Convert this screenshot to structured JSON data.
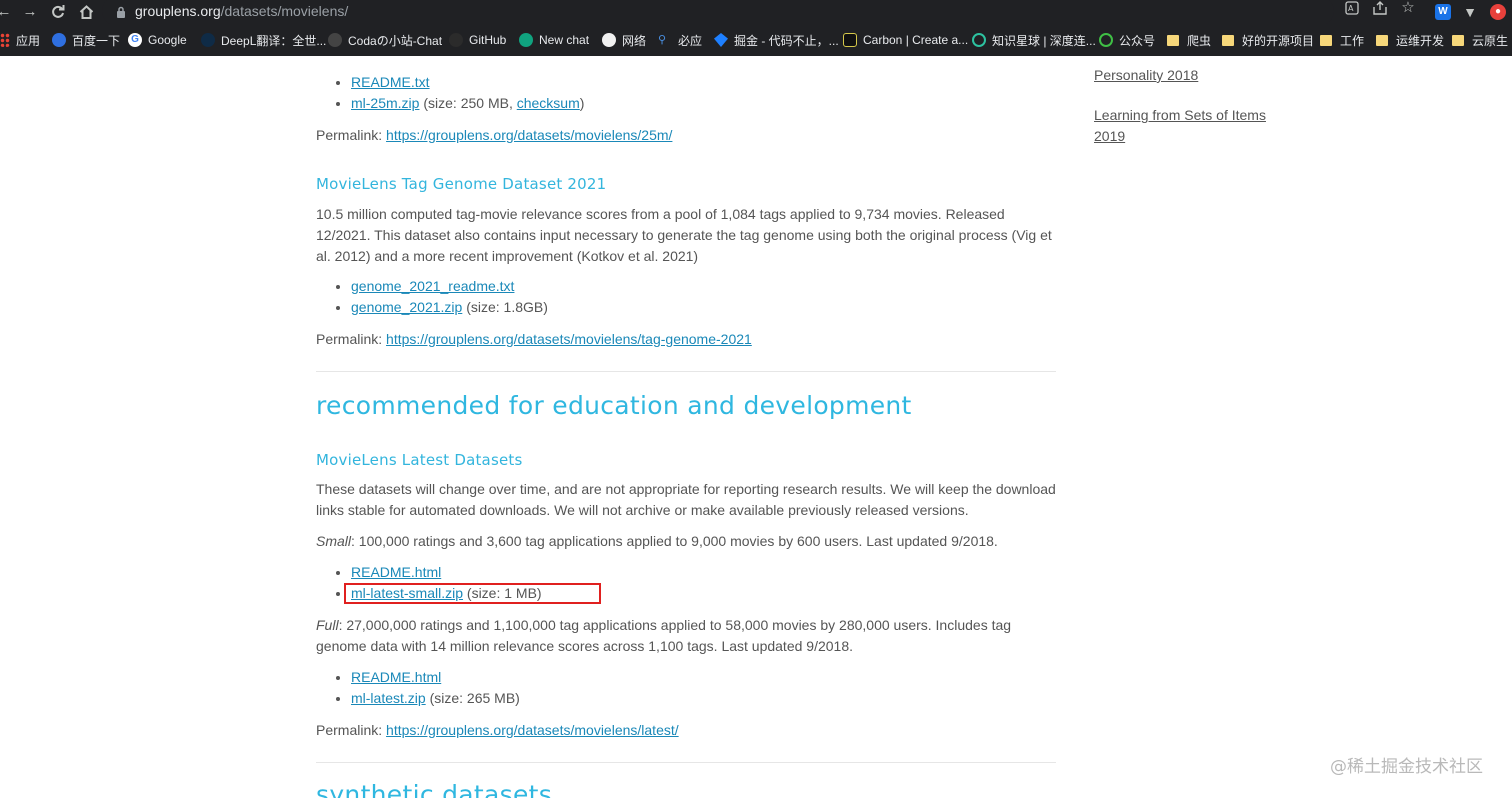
{
  "browser": {
    "url_host": "grouplens.org",
    "url_path": "/datasets/movielens/",
    "icons": {
      "back": "back-arrow-icon",
      "forward": "forward-arrow-icon",
      "reload": "reload-icon",
      "home": "home-icon",
      "lock": "lock-icon",
      "translate": "translate-icon",
      "share": "share-icon",
      "star": "star-icon",
      "extension_w": "w-extension-icon",
      "extension_v": "v-extension-icon",
      "extension_red": "red-extension-icon"
    },
    "bookmarks": [
      {
        "label": "应用",
        "icon": "apps-grid-icon"
      },
      {
        "label": "百度一下",
        "icon": "baidu-icon"
      },
      {
        "label": "Google",
        "icon": "google-icon"
      },
      {
        "label": "DeepL翻译：全世...",
        "icon": "deepl-icon"
      },
      {
        "label": "Codaの小站-Chat",
        "icon": "coda-icon"
      },
      {
        "label": "GitHub",
        "icon": "github-icon"
      },
      {
        "label": "New chat",
        "icon": "openai-icon"
      },
      {
        "label": "网络",
        "icon": "panda-icon"
      },
      {
        "label": "必应",
        "icon": "bing-search-icon"
      },
      {
        "label": "掘金 - 代码不止，...",
        "icon": "juejin-icon"
      },
      {
        "label": "Carbon | Create a...",
        "icon": "carbon-icon"
      },
      {
        "label": "知识星球 | 深度连...",
        "icon": "zsxq-icon"
      },
      {
        "label": "公众号",
        "icon": "wechat-icon"
      },
      {
        "label": "爬虫",
        "icon": "folder-icon"
      },
      {
        "label": "好的开源项目",
        "icon": "folder-icon"
      },
      {
        "label": "工作",
        "icon": "folder-icon"
      },
      {
        "label": "运维开发",
        "icon": "folder-icon"
      },
      {
        "label": "云原生",
        "icon": "folder-icon"
      }
    ]
  },
  "page": {
    "sidebar": {
      "links": [
        "Personality 2018",
        "Learning from Sets of Items 2019"
      ]
    },
    "ml25m": {
      "files": [
        {
          "link": "README.txt",
          "meta": ""
        },
        {
          "link": "ml-25m.zip",
          "meta_before": " (size: 250 MB, ",
          "meta_link": "checksum",
          "meta_after": ")"
        }
      ],
      "permalink_label": "Permalink: ",
      "permalink": "https://grouplens.org/datasets/movielens/25m/"
    },
    "genome": {
      "title": "MovieLens Tag Genome Dataset 2021",
      "description": "10.5 million computed tag-movie relevance scores from a pool of 1,084 tags applied to 9,734 movies. Released 12/2021. This dataset also contains input necessary to generate the tag genome using both the original process (Vig et al. 2012) and a more recent improvement (Kotkov et al. 2021)",
      "files": [
        {
          "link": "genome_2021_readme.txt",
          "meta": ""
        },
        {
          "link": "genome_2021.zip",
          "meta": " (size: 1.8GB)"
        }
      ],
      "permalink_label": "Permalink: ",
      "permalink": "https://grouplens.org/datasets/movielens/tag-genome-2021"
    },
    "education_section_title": "recommended for education and development",
    "latest": {
      "title": "MovieLens Latest Datasets",
      "description": "These datasets will change over time, and are not appropriate for reporting research results. We will keep the download links stable for automated downloads. We will not archive or make available previously released versions.",
      "small_label": "Small",
      "small_text": ": 100,000 ratings and 3,600 tag applications applied to 9,000 movies by 600 users. Last updated 9/2018.",
      "small_files": [
        {
          "link": "README.html",
          "meta": ""
        },
        {
          "link": "ml-latest-small.zip",
          "meta": " (size: 1 MB)"
        }
      ],
      "full_label": "Full",
      "full_text": ": 27,000,000 ratings and 1,100,000 tag applications applied to 58,000 movies by 280,000 users. Includes tag genome data with 14 million relevance scores across 1,100 tags. Last updated 9/2018.",
      "full_files": [
        {
          "link": "README.html",
          "meta": ""
        },
        {
          "link": "ml-latest.zip",
          "meta": " (size: 265 MB)"
        }
      ],
      "permalink_label": "Permalink: ",
      "permalink": "https://grouplens.org/datasets/movielens/latest/"
    },
    "synthetic_section_title": "synthetic datasets",
    "watermark": "@稀土掘金技术社区",
    "highlight_color": "#e0201f",
    "link_color": "#1a88b8",
    "heading_color": "#33b5dd"
  }
}
